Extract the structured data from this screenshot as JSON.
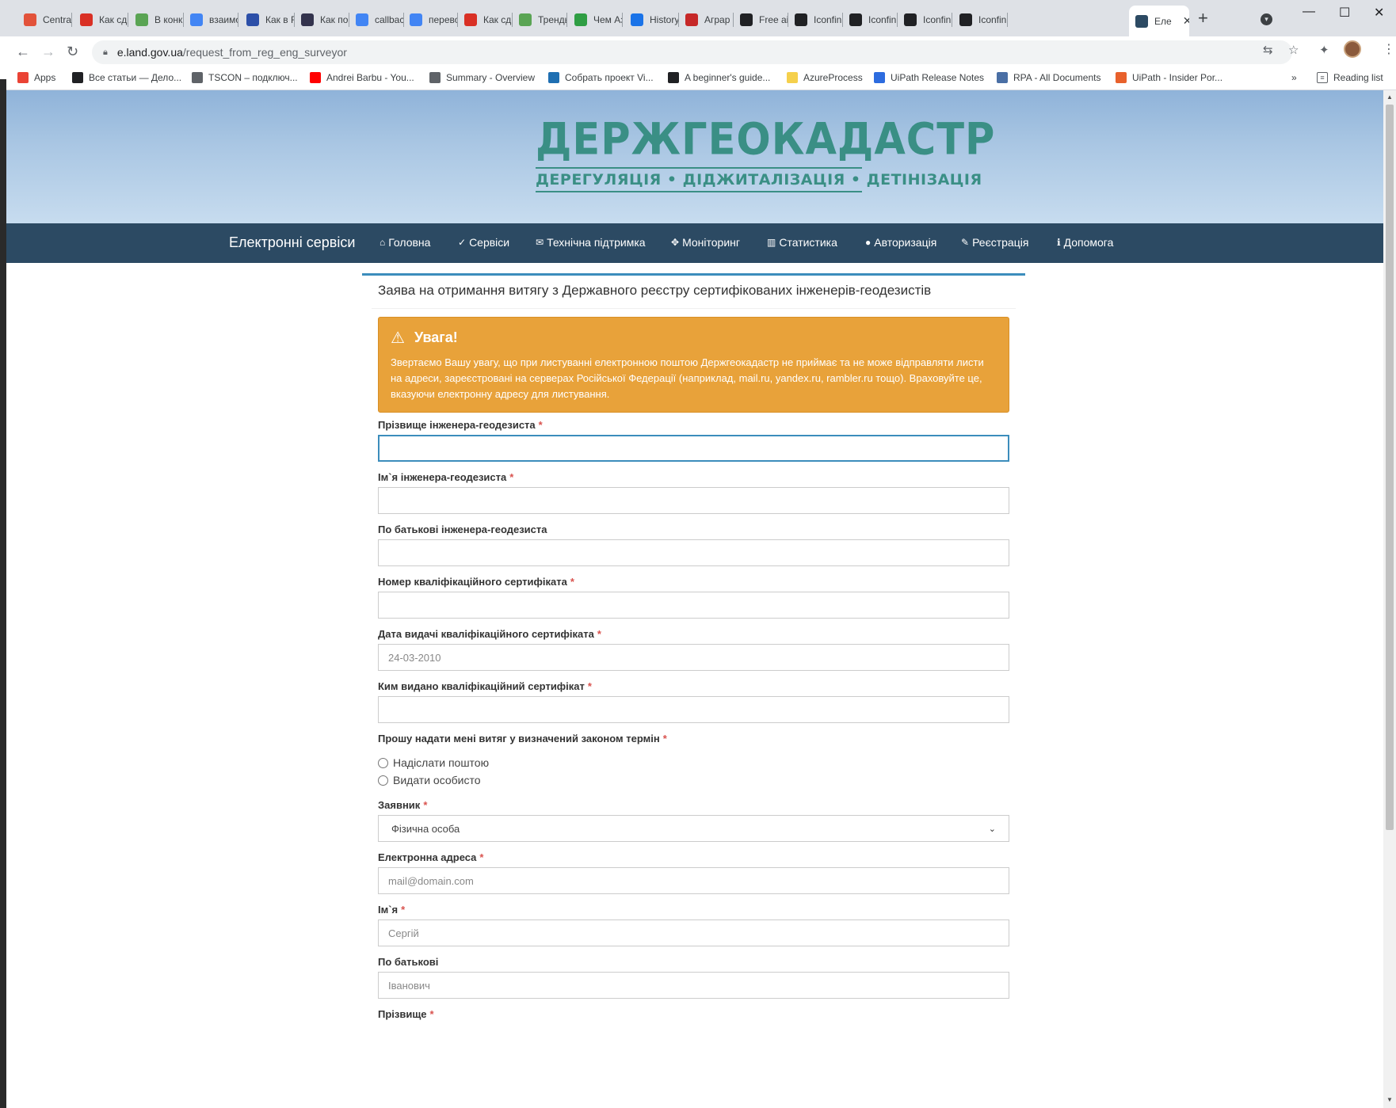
{
  "browser": {
    "tabs": [
      {
        "title": "Centra",
        "icon": "red-doc-icon",
        "color": "#e2523a"
      },
      {
        "title": "Как сд",
        "icon": "blocked-red-icon",
        "color": "#d93025"
      },
      {
        "title": "В конк",
        "icon": "green-stack-icon",
        "color": "#5aa454"
      },
      {
        "title": "взаимо",
        "icon": "google-g-icon",
        "color": "#4285f4"
      },
      {
        "title": "Как в F",
        "icon": "ui-logo-icon",
        "color": "#2c4fa8"
      },
      {
        "title": "Как по",
        "icon": "dark-square-icon",
        "color": "#33334d"
      },
      {
        "title": "callbac",
        "icon": "google-g-icon",
        "color": "#4285f4"
      },
      {
        "title": "перево",
        "icon": "google-g-icon",
        "color": "#4285f4"
      },
      {
        "title": "Как сд",
        "icon": "blocked-red-icon",
        "color": "#d93025"
      },
      {
        "title": "Тренды",
        "icon": "green-stack-icon",
        "color": "#5aa454"
      },
      {
        "title": "Чем Аз",
        "icon": "green-hex-icon",
        "color": "#2f9e44"
      },
      {
        "title": "History",
        "icon": "history-icon",
        "color": "#1a73e8"
      },
      {
        "title": "Аграр",
        "icon": "red-book-icon",
        "color": "#c62828"
      },
      {
        "title": "Free ai",
        "icon": "iconfinder-icon",
        "color": "#202124"
      },
      {
        "title": "Iconfin",
        "icon": "iconfinder-icon",
        "color": "#202124"
      },
      {
        "title": "Iconfin",
        "icon": "iconfinder-icon",
        "color": "#202124"
      },
      {
        "title": "Iconfin",
        "icon": "iconfinder-icon",
        "color": "#202124"
      },
      {
        "title": "Iconfin",
        "icon": "iconfinder-icon",
        "color": "#202124"
      },
      {
        "title": "Еле",
        "icon": "e-letter-icon",
        "color": "#2c4a63",
        "active": true
      }
    ],
    "url_domain": "e.land.gov.ua",
    "url_path": "/request_from_reg_eng_surveyor",
    "bookmarks": [
      {
        "label": "Apps",
        "icon": "apps-grid-icon",
        "color": "#ea4335"
      },
      {
        "label": "Все статьи — Дело...",
        "icon": "d-letter-icon",
        "color": "#202124"
      },
      {
        "label": "TSCON – подключ...",
        "icon": "globe-icon",
        "color": "#5f6368"
      },
      {
        "label": "Andrei Barbu - You...",
        "icon": "youtube-icon",
        "color": "#ff0000"
      },
      {
        "label": "Summary - Overview",
        "icon": "globe-icon",
        "color": "#5f6368"
      },
      {
        "label": "Собрать проект Vi...",
        "icon": "gear-square-icon",
        "color": "#1f6fb2"
      },
      {
        "label": "A beginner's guide...",
        "icon": "a-logo-icon",
        "color": "#202124"
      },
      {
        "label": "AzureProcess",
        "icon": "folder-icon",
        "color": "#f5d04c"
      },
      {
        "label": "UiPath Release Notes",
        "icon": "uipath-icon",
        "color": "#2d6cdf"
      },
      {
        "label": "RPA - All Documents",
        "icon": "sharepoint-icon",
        "color": "#4a6fa5"
      },
      {
        "label": "UiPath - Insider Por...",
        "icon": "uipath-orange-icon",
        "color": "#e8612c"
      }
    ],
    "reading_list": "Reading list",
    "more_bookmarks": "»"
  },
  "site": {
    "logo_title": "ДЕРЖГЕОКАДАСТР",
    "logo_subtitle": "ДЕРЕГУЛЯЦІЯ • ДІДЖИТАЛІЗАЦІЯ • ДЕТІНІЗАЦІЯ",
    "brand": "Електронні сервіси",
    "nav": [
      {
        "label": "Головна",
        "icon": "home-icon",
        "glyph": "⌂"
      },
      {
        "label": "Сервіси",
        "icon": "check-circle-icon",
        "glyph": "✓"
      },
      {
        "label": "Технічна підтримка",
        "icon": "envelope-icon",
        "glyph": "✉"
      },
      {
        "label": "Моніторинг",
        "icon": "crosshair-icon",
        "glyph": "✥"
      },
      {
        "label": "Статистика",
        "icon": "bar-chart-icon",
        "glyph": "▥"
      },
      {
        "label": "Авторизація",
        "icon": "user-icon",
        "glyph": "●"
      },
      {
        "label": "Реєстрація",
        "icon": "edit-icon",
        "glyph": "✎"
      },
      {
        "label": "Допомога",
        "icon": "info-circle-icon",
        "glyph": "ℹ"
      }
    ]
  },
  "form": {
    "title": "Заява на отримання витягу з Державного реєстру сертифікованих інженерів-геодезистів",
    "alert_title": "Увага!",
    "alert_text": "Звертаємо Вашу увагу, що при листуванні електронною поштою Держгеокадастр не приймає та не може відправляти листи на адреси, зареєстровані на серверах Російської Федерації (наприклад, mail.ru, yandex.ru, rambler.ru тощо). Враховуйте це, вказуючи електронну адресу для листування.",
    "required_mark": "*",
    "surname_label": "Прізвище інженера-геодезиста",
    "surname_value": "",
    "name_label": "Ім`я інженера-геодезиста",
    "name_value": "",
    "patronymic_label": "По батькові інженера-геодезиста",
    "patronymic_value": "",
    "cert_number_label": "Номер кваліфікаційного сертифіката",
    "cert_number_value": "",
    "cert_date_label": "Дата видачі кваліфікаційного сертифіката",
    "cert_date_placeholder": "24-03-2010",
    "cert_issuer_label": "Ким видано кваліфікаційний сертифікат",
    "cert_issuer_value": "",
    "delivery_label": "Прошу надати мені витяг у визначений законом термін",
    "delivery_options": [
      "Надіслати поштою",
      "Видати особисто"
    ],
    "applicant_label": "Заявник",
    "applicant_selected": "Фізична особа",
    "email_label": "Електронна адреса",
    "email_placeholder": "mail@domain.com",
    "first_name_label": "Ім`я",
    "first_name_placeholder": "Сергій",
    "middle_name_label": "По батькові",
    "middle_name_placeholder": "Іванович",
    "last_name_label": "Прізвище"
  }
}
